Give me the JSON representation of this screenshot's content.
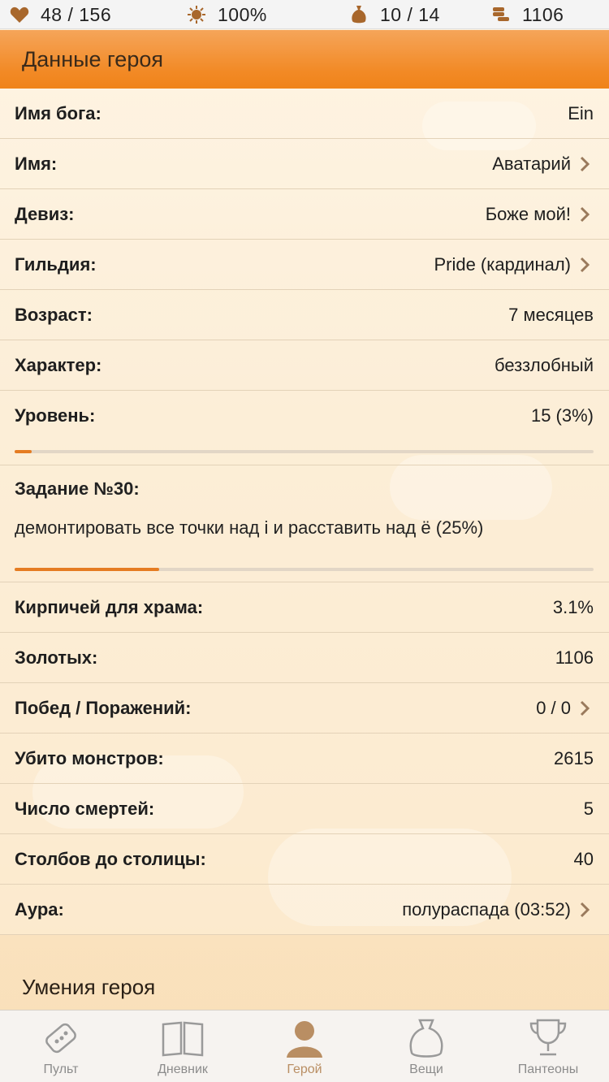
{
  "status": {
    "health": "48 / 156",
    "godpower": "100%",
    "inventory": "10 / 14",
    "gold": "1106"
  },
  "header": {
    "title": "Данные героя"
  },
  "rows": [
    {
      "label": "Имя бога:",
      "value": "Ein"
    },
    {
      "label": "Имя:",
      "value": "Аватарий"
    },
    {
      "label": "Девиз:",
      "value": "Боже мой!"
    },
    {
      "label": "Гильдия:",
      "value": "Pride (кардинал)"
    },
    {
      "label": "Возраст:",
      "value": "7 месяцев"
    },
    {
      "label": "Характер:",
      "value": "беззлобный"
    }
  ],
  "level": {
    "label": "Уровень:",
    "value": "15 (3%)",
    "progress_percent": 3
  },
  "quest": {
    "title": "Задание №30:",
    "text": "демонтировать все точки над і и расставить над ё (25%)",
    "progress_percent": 25
  },
  "stats": [
    {
      "label": "Кирпичей для храма:",
      "value": "3.1%"
    },
    {
      "label": "Золотых:",
      "value": "1106"
    },
    {
      "label": "Побед / Поражений:",
      "value": "0 / 0"
    },
    {
      "label": "Убито монстров:",
      "value": "2615"
    },
    {
      "label": "Число смертей:",
      "value": "5"
    },
    {
      "label": "Столбов до столицы:",
      "value": "40"
    },
    {
      "label": "Аура:",
      "value": "полураспада (03:52)"
    }
  ],
  "skills": {
    "title": "Умения героя"
  },
  "tabs": [
    {
      "label": "Пульт",
      "icon": "remote-icon"
    },
    {
      "label": "Дневник",
      "icon": "book-icon"
    },
    {
      "label": "Герой",
      "icon": "hero-icon",
      "active": true
    },
    {
      "label": "Вещи",
      "icon": "bag-icon"
    },
    {
      "label": "Пантеоны",
      "icon": "trophy-icon"
    }
  ],
  "colors": {
    "accent_orange": "#f28a26",
    "progress_fill": "#e57c22",
    "stat_icon_brown": "#a8672c",
    "tab_active": "#b98e63",
    "tab_inactive": "#8c8c8c"
  }
}
